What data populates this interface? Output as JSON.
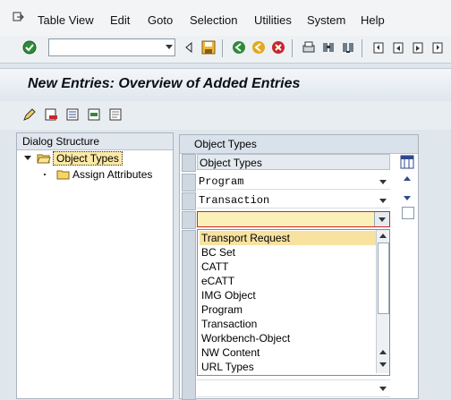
{
  "menubar": {
    "items": [
      "Table View",
      "Edit",
      "Goto",
      "Selection",
      "Utilities",
      "System",
      "Help"
    ]
  },
  "toolbar": {
    "command_field_value": "",
    "icons": [
      "enter-icon",
      "save-icon",
      "back-icon",
      "exit-icon",
      "cancel-icon",
      "print-icon",
      "find-icon",
      "find-next-icon",
      "first-page-icon",
      "previous-page-icon",
      "next-page-icon",
      "last-page-icon"
    ]
  },
  "page": {
    "title": "New Entries: Overview of Added Entries"
  },
  "app_toolbar": {
    "icons": [
      "change-display-icon",
      "delete-icon",
      "select-all-icon",
      "select-block-icon",
      "deselect-all-icon"
    ]
  },
  "dialog_structure": {
    "header": "Dialog Structure",
    "items": [
      {
        "label": "Object Types",
        "selected": true
      },
      {
        "label": "Assign Attributes",
        "selected": false
      }
    ]
  },
  "object_types": {
    "panel_title": "Object Types",
    "column_header": "Object Types",
    "rows": [
      "Program",
      "Transaction",
      ""
    ],
    "dropdown_options": [
      "Transport Request",
      "BC Set",
      "CATT",
      "eCATT",
      "IMG Object",
      "Program",
      "Transaction",
      "Workbench-Object",
      "NW Content",
      "URL Types"
    ],
    "highlighted_option": "Transport Request"
  },
  "colors": {
    "accent": "#f8e2a0",
    "title_bg": "#dfe6ee",
    "panel_bg": "#ffffff",
    "selected_tree_bg": "#fbe9a6"
  }
}
